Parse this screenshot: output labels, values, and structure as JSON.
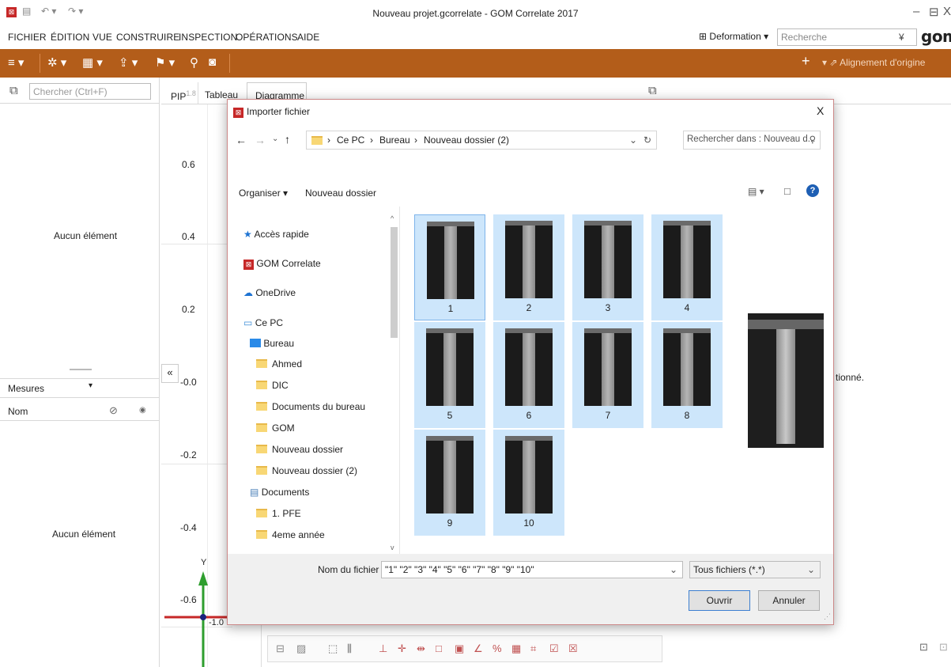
{
  "window": {
    "title": "Nouveau projet.gcorrelate - GOM Correlate 2017",
    "controls": [
      "–",
      "⊟",
      "X"
    ]
  },
  "menubar": {
    "items": [
      "FICHIER",
      "ÉDITION",
      "VUE",
      "CONSTRUIRE",
      "INSPECTION",
      "OPÉRATIONS",
      "AIDE"
    ],
    "deformation_label": "Deformation",
    "search_placeholder": "Recherche",
    "brand": "gom"
  },
  "toolbar": {
    "align_label": "Alignement d'origine"
  },
  "explorer": {
    "search_placeholder": "Chercher (Ctrl+F)",
    "empty_top": "Aucun élément",
    "measures_label": "Mesures",
    "name_column": "Nom",
    "empty_bottom": "Aucun élément"
  },
  "tabs": {
    "pip": "PIP",
    "pip_suffix": "1.8",
    "tableau": "Tableau",
    "diagramme": "Diagramme"
  },
  "graph": {
    "yticks": [
      "0.6",
      "0.4",
      "0.2",
      "-0.0",
      "-0.2",
      "-0.4",
      "-0.6"
    ],
    "axis_y": "Y",
    "x_value": "-1.0",
    "collapse": "«",
    "hidden_text": "tionné."
  },
  "dialog": {
    "title": "Importer fichier",
    "close": "X",
    "breadcrumb": [
      "Ce PC",
      "Bureau",
      "Nouveau dossier (2)"
    ],
    "search_placeholder": "Rechercher dans : Nouveau d...",
    "organize": "Organiser",
    "new_folder": "Nouveau dossier",
    "nav": [
      {
        "label": "Accès rapide",
        "icon": "star-icon"
      },
      {
        "label": "GOM Correlate",
        "icon": "gom-app-icon"
      },
      {
        "label": "OneDrive",
        "icon": "cloud-icon"
      },
      {
        "label": "Ce PC",
        "icon": "computer-icon"
      },
      {
        "label": "Bureau",
        "icon": "desktop-icon"
      },
      {
        "label": "Ahmed",
        "icon": "folder-icon"
      },
      {
        "label": "DIC",
        "icon": "folder-icon"
      },
      {
        "label": "Documents du bureau",
        "icon": "folder-icon"
      },
      {
        "label": "GOM",
        "icon": "folder-icon"
      },
      {
        "label": "Nouveau dossier",
        "icon": "folder-icon"
      },
      {
        "label": "Nouveau dossier (2)",
        "icon": "folder-icon"
      },
      {
        "label": "Documents",
        "icon": "documents-icon"
      },
      {
        "label": "1. PFE",
        "icon": "folder-icon"
      },
      {
        "label": "4eme année",
        "icon": "folder-icon"
      }
    ],
    "files": [
      "1",
      "2",
      "3",
      "4",
      "5",
      "6",
      "7",
      "8",
      "9",
      "10"
    ],
    "filename_label": "Nom du fichier :",
    "filename_value": "\"1\" \"2\" \"3\" \"4\" \"5\" \"6\" \"7\" \"8\" \"9\" \"10\"",
    "filetype": "Tous fichiers (*.*)",
    "open": "Ouvrir",
    "cancel": "Annuler"
  }
}
